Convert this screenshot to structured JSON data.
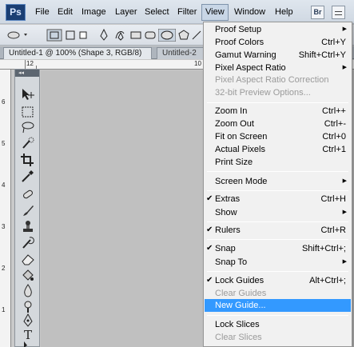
{
  "app": {
    "logo": "Ps"
  },
  "menubar": {
    "items": [
      {
        "label": "File"
      },
      {
        "label": "Edit"
      },
      {
        "label": "Image"
      },
      {
        "label": "Layer"
      },
      {
        "label": "Select"
      },
      {
        "label": "Filter"
      },
      {
        "label": "View"
      },
      {
        "label": "Window"
      },
      {
        "label": "Help"
      }
    ],
    "bridge_label": "Br"
  },
  "tabs": [
    {
      "label": "Untitled-1 @ 100% (Shape 3, RGB/8) *"
    },
    {
      "label": "Untitled-2 @"
    }
  ],
  "rulers": {
    "top_labels": [
      "12",
      "10"
    ],
    "left_labels": [
      "6",
      "5",
      "4",
      "3",
      "2",
      "1"
    ]
  },
  "view_menu": {
    "items": [
      {
        "label": "Proof Setup",
        "shortcut": "",
        "submenu": true
      },
      {
        "label": "Proof Colors",
        "shortcut": "Ctrl+Y"
      },
      {
        "label": "Gamut Warning",
        "shortcut": "Shift+Ctrl+Y"
      },
      {
        "label": "Pixel Aspect Ratio",
        "shortcut": "",
        "submenu": true
      },
      {
        "label": "Pixel Aspect Ratio Correction",
        "disabled": true
      },
      {
        "label": "32-bit Preview Options...",
        "disabled": true
      },
      {
        "label": "Zoom In",
        "shortcut": "Ctrl++"
      },
      {
        "label": "Zoom Out",
        "shortcut": "Ctrl+-"
      },
      {
        "label": "Fit on Screen",
        "shortcut": "Ctrl+0"
      },
      {
        "label": "Actual Pixels",
        "shortcut": "Ctrl+1"
      },
      {
        "label": "Print Size",
        "shortcut": ""
      },
      {
        "label": "Screen Mode",
        "shortcut": "",
        "submenu": true
      },
      {
        "label": "Extras",
        "shortcut": "Ctrl+H",
        "checked": true
      },
      {
        "label": "Show",
        "shortcut": "",
        "submenu": true
      },
      {
        "label": "Rulers",
        "shortcut": "Ctrl+R",
        "checked": true
      },
      {
        "label": "Snap",
        "shortcut": "Shift+Ctrl+;",
        "checked": true
      },
      {
        "label": "Snap To",
        "shortcut": "",
        "submenu": true
      },
      {
        "label": "Lock Guides",
        "shortcut": "Alt+Ctrl+;",
        "checked": true
      },
      {
        "label": "Clear Guides",
        "disabled": true
      },
      {
        "label": "New Guide...",
        "highlighted": true
      },
      {
        "label": "Lock Slices",
        "shortcut": ""
      },
      {
        "label": "Clear Slices",
        "disabled": true
      }
    ]
  },
  "colors": {
    "highlight": "#3399ff",
    "menu_bg": "#f1f1f1",
    "disabled_text": "#9a9a9a"
  }
}
